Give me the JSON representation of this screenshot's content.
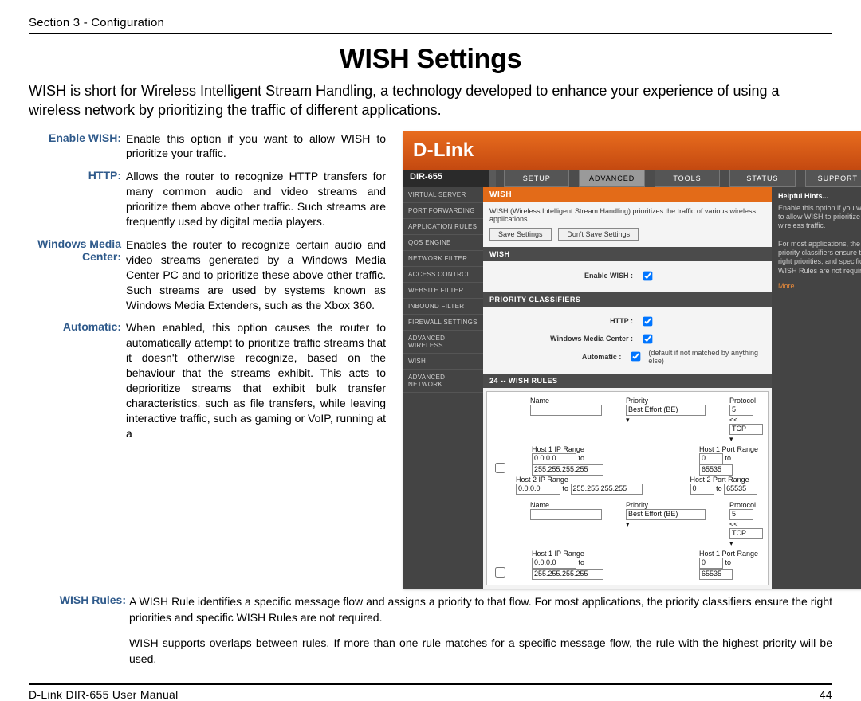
{
  "header": {
    "left": "Section 3 - Configuration"
  },
  "title": "WISH Settings",
  "intro": "WISH is short for Wireless Intelligent Stream Handling, a technology developed to enhance your experience of using a wireless network by prioritizing the traffic of different applications.",
  "defs": {
    "enable_wish": {
      "label": "Enable WISH:",
      "text": "Enable this option if you want to allow WISH to prioritize your traffic."
    },
    "http": {
      "label": "HTTP:",
      "text": "Allows the router to recognize HTTP transfers for many common audio and video streams and prioritize them above other traffic. Such streams are frequently used by digital media players."
    },
    "wmc": {
      "label": "Windows Media Center:",
      "text": "Enables the router to recognize certain audio and video streams generated by a Windows Media Center PC and to prioritize these above other traffic. Such streams are used by systems known as Windows Media Extenders, such as the Xbox 360."
    },
    "auto": {
      "label": "Automatic:",
      "text": "When enabled, this option causes the router to automatically attempt to prioritize traffic streams that it doesn't otherwise recognize, based on the behaviour that the streams exhibit. This acts to deprioritize streams that exhibit bulk transfer characteristics, such as file transfers, while leaving interactive traffic, such as gaming or VoIP, running at a"
    },
    "rules": {
      "label": "WISH Rules:",
      "p1": "A WISH Rule identifies a specific message flow and assigns a priority to that flow. For most applications, the priority classifiers ensure the right priorities and specific WISH Rules are not required.",
      "p2": "WISH supports overlaps between rules. If more than one rule matches for a specific message flow, the rule with the highest priority will be used."
    }
  },
  "footer": {
    "left": "D-Link DIR-655 User Manual",
    "right": "44"
  },
  "shot": {
    "brand": "D-Link",
    "model": "DIR-655",
    "tabs": [
      "SETUP",
      "ADVANCED",
      "TOOLS",
      "STATUS",
      "SUPPORT"
    ],
    "active_tab": "ADVANCED",
    "sidenav": [
      "VIRTUAL SERVER",
      "PORT FORWARDING",
      "APPLICATION RULES",
      "QOS ENGINE",
      "NETWORK FILTER",
      "ACCESS CONTROL",
      "WEBSITE FILTER",
      "INBOUND FILTER",
      "FIREWALL SETTINGS",
      "ADVANCED WIRELESS",
      "WISH",
      "ADVANCED NETWORK"
    ],
    "panel": {
      "title": "WISH",
      "desc": "WISH (Wireless Intelligent Stream Handling) prioritizes the traffic of various wireless applications.",
      "save": "Save Settings",
      "dont_save": "Don't Save Settings"
    },
    "wish_section": {
      "title": "WISH",
      "enable_label": "Enable WISH :"
    },
    "classifiers": {
      "title": "PRIORITY CLASSIFIERS",
      "http": "HTTP :",
      "wmc": "Windows Media Center :",
      "auto": "Automatic :",
      "auto_note": "(default if not matched by anything else)"
    },
    "rules": {
      "title": "24 -- WISH RULES",
      "hdr_name": "Name",
      "hdr_priority": "Priority",
      "hdr_protocol": "Protocol",
      "priority_val": "Best Effort (BE)",
      "proto_num": "5",
      "proto_sep": "<<",
      "proto_val": "TCP",
      "h1ip": "Host 1 IP Range",
      "h1port": "Host 1 Port Range",
      "h2ip": "Host 2 IP Range",
      "h2port": "Host 2 Port Range",
      "ip_from": "0.0.0.0",
      "ip_to_lbl": "to",
      "ip_to": "255.255.255.255",
      "port_from": "0",
      "port_to": "65535"
    },
    "hints": {
      "title": "Helpful Hints...",
      "p1": "Enable this option if you want to allow WISH to prioritize wireless traffic.",
      "p2": "For most applications, the priority classifiers ensure the right priorities, and specific WISH Rules are not required.",
      "more": "More..."
    }
  }
}
